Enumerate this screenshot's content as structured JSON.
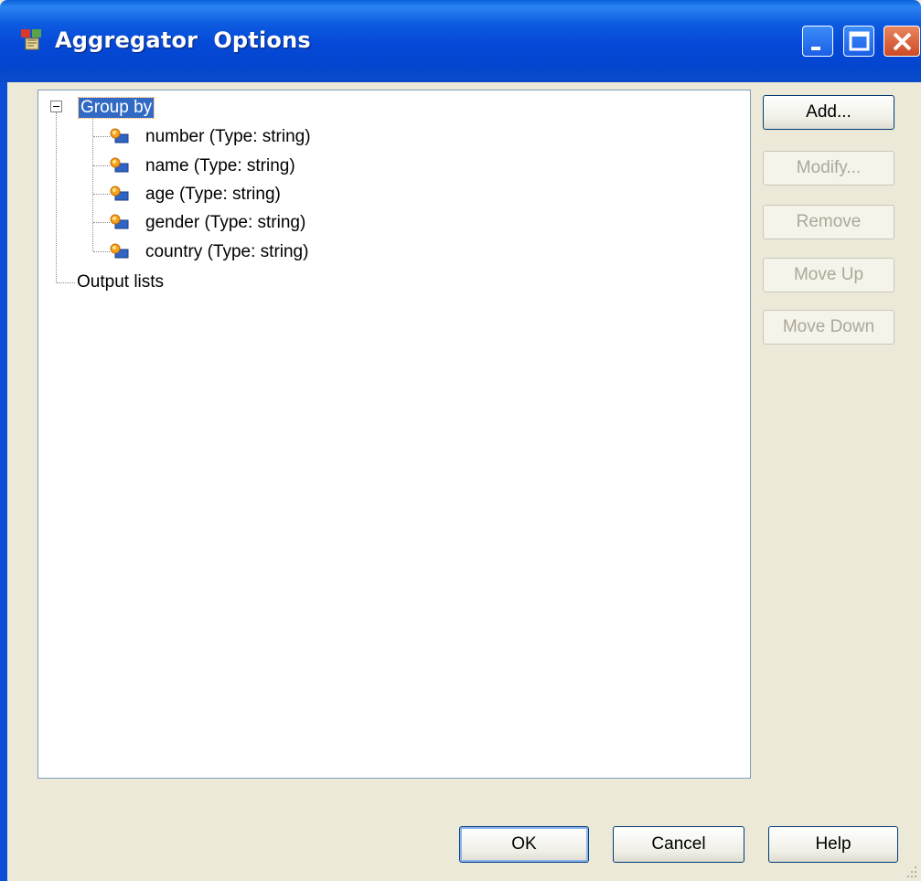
{
  "window": {
    "title": "Aggregator  Options"
  },
  "tree": {
    "root": {
      "label": "Group by"
    },
    "items": [
      {
        "label": "number (Type: string)"
      },
      {
        "label": "name (Type: string)"
      },
      {
        "label": "age (Type: string)"
      },
      {
        "label": "gender (Type: string)"
      },
      {
        "label": "country (Type: string)"
      }
    ],
    "second_root": {
      "label": "Output lists"
    }
  },
  "side_buttons": {
    "add": "Add...",
    "modify": "Modify...",
    "remove": "Remove",
    "move_up": "Move Up",
    "move_down": "Move Down"
  },
  "bottom_buttons": {
    "ok": "OK",
    "cancel": "Cancel",
    "help": "Help"
  },
  "colors": {
    "titlebar": "#0548d6",
    "selection": "#316ac5",
    "face": "#ece9d8"
  }
}
